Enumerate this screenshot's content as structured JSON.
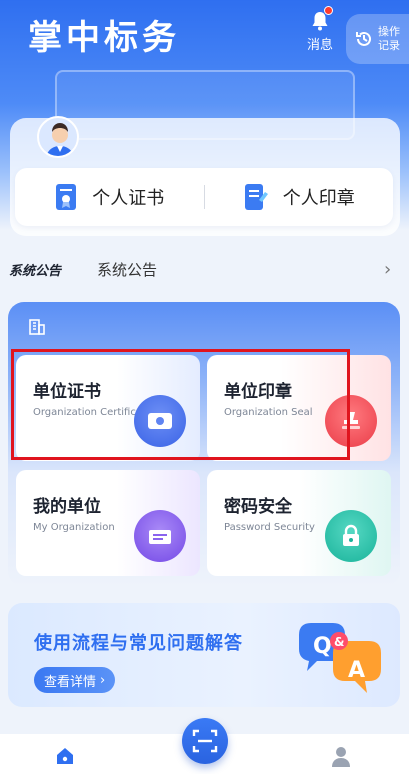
{
  "app": {
    "title": "掌中标务"
  },
  "header": {
    "message_label": "消息",
    "records_label_line1": "操作",
    "records_label_line2": "记录",
    "accent": "#2f6ff0",
    "badge_color": "#ff3b30"
  },
  "profile": {
    "personal_certificate": "个人证书",
    "personal_seal": "个人印章"
  },
  "notice": {
    "tag": "系统公告",
    "text": "系统公告"
  },
  "services": {
    "items": [
      {
        "title": "单位证书",
        "subtitle": "Organization Certificate",
        "icon": "certificate-icon"
      },
      {
        "title": "单位印章",
        "subtitle": "Organization Seal",
        "icon": "seal-icon"
      },
      {
        "title": "我的单位",
        "subtitle": "My Organization",
        "icon": "organization-icon"
      },
      {
        "title": "密码安全",
        "subtitle": "Password Security",
        "icon": "lock-icon"
      }
    ]
  },
  "faq_banner": {
    "title": "使用流程与常见问题解答",
    "button": "查看详情",
    "art_q": "Q",
    "art_amp": "&",
    "art_a": "A"
  },
  "tabbar": {
    "home_icon": "home-icon",
    "scan_icon": "scan-icon",
    "user_icon": "user-icon"
  }
}
